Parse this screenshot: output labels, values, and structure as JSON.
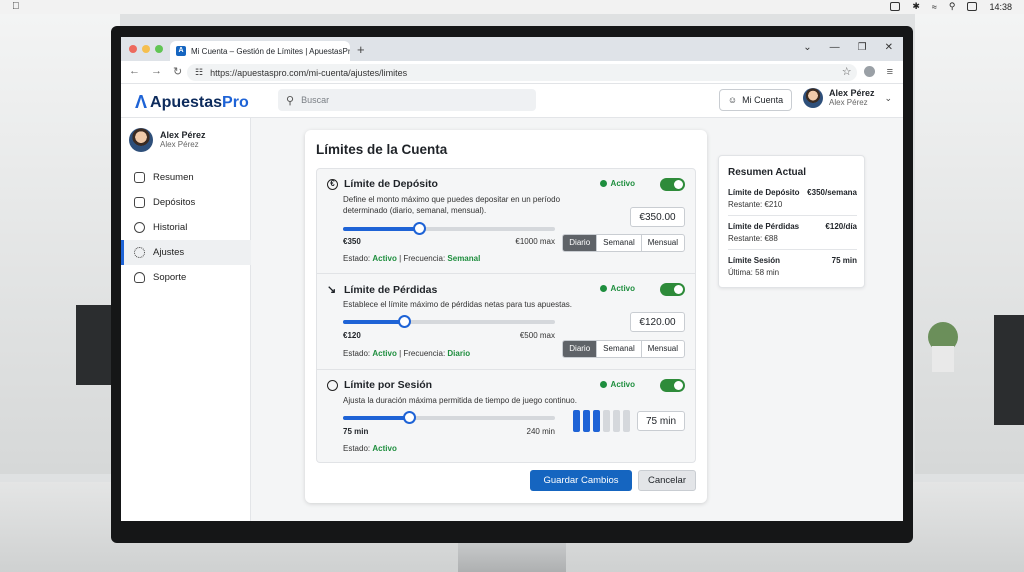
{
  "menubar": {
    "clock": "14:38"
  },
  "browser": {
    "tab_title": "Mi Cuenta – Gestión de Límites | ApuestasPro",
    "url": "https://apuestaspro.com/mi-cuenta/ajustes/limites"
  },
  "header": {
    "logo_main": "Apuestas",
    "logo_accent": "Pro",
    "search_placeholder": "Buscar",
    "account_button": "Mi Cuenta",
    "user_name": "Alex Pérez",
    "user_sub": "Alex Pérez"
  },
  "sidebar": {
    "user_name": "Alex Pérez",
    "user_sub": "Alex Pérez",
    "items": [
      {
        "label": "Resumen"
      },
      {
        "label": "Depósitos"
      },
      {
        "label": "Historial"
      },
      {
        "label": "Ajustes"
      },
      {
        "label": "Soporte"
      }
    ]
  },
  "limits": {
    "title": "Límites de la Cuenta",
    "deposit": {
      "title": "Límite de Depósito",
      "description": "Define el monto máximo que puedes depositar en un período determinado (diario, semanal, mensual).",
      "badge": "Activo",
      "value": "€350.00",
      "min_label": "€350",
      "max_label": "€1000 max",
      "slider_fraction": 0.36,
      "periods": [
        "Diario",
        "Semanal",
        "Mensual"
      ],
      "selected_period": "Diario",
      "status_prefix": "Estado:",
      "status_value": "Activo",
      "freq_prefix": "| Frecuencia:",
      "freq_value": "Semanal"
    },
    "losses": {
      "title": "Límite de Pérdidas",
      "description": "Establece el límite máximo de pérdidas netas para tus apuestas.",
      "badge": "Activo",
      "value": "€120.00",
      "min_label": "€120",
      "max_label": "€500 max",
      "slider_fraction": 0.29,
      "periods": [
        "Diario",
        "Semanal",
        "Mensual"
      ],
      "selected_period": "Diario",
      "status_prefix": "Estado:",
      "status_value": "Activo",
      "freq_prefix": "| Frecuencia:",
      "freq_value": "Diario"
    },
    "session": {
      "title": "Límite por Sesión",
      "description": "Ajusta la duración máxima permitida de tiempo de juego continuo.",
      "badge": "Activo",
      "value": "75 min",
      "min_label": "75 min",
      "max_label": "240 min",
      "slider_fraction": 0.31,
      "bars_filled": 3,
      "bars_total": 6,
      "status_prefix": "Estado:",
      "status_value": "Activo"
    },
    "save_button": "Guardar Cambios",
    "cancel_button": "Cancelar"
  },
  "summary": {
    "title": "Resumen Actual",
    "rows": [
      {
        "label": "Límite de Depósito",
        "value": "€350/semana",
        "sub": "Restante: €210"
      },
      {
        "label": "Límite de Pérdidas",
        "value": "€120/día",
        "sub": "Restante: €88"
      },
      {
        "label": "Límite Sesión",
        "value": "75 min",
        "sub": "Última: 58 min"
      }
    ]
  },
  "colors": {
    "accent": "#1e63d6",
    "active_green": "#1e8e3e",
    "logo_dark": "#0d2b5c"
  }
}
